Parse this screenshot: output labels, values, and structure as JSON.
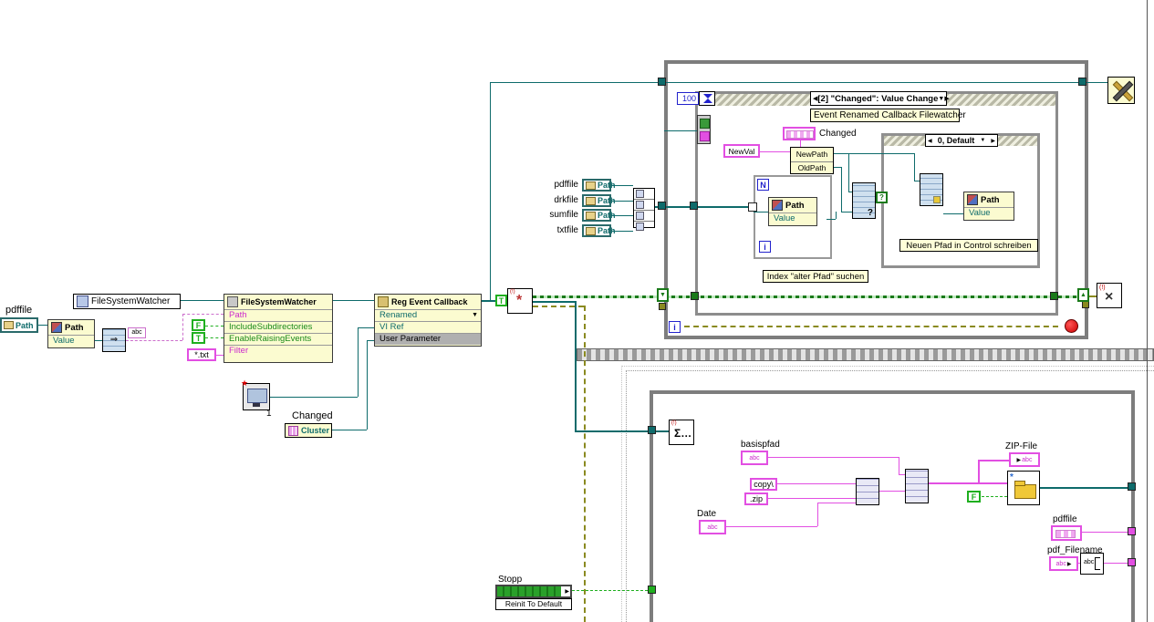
{
  "colors": {
    "wire_path": "#0e6b6b",
    "wire_string": "#e24fe2",
    "wire_bool": "#1faf1f",
    "wire_error": "#8a8a20",
    "wire_numeric": "#2222cc",
    "node_bg": "#fbfbd0",
    "free_label_bg": "#ffffd8",
    "structure_border": "#7d7d7d"
  },
  "glyphs": {
    "left_arrow": "◀",
    "right_arrow": "▶",
    "down_arrow": "▼",
    "up_arrow": "▲",
    "question": "?",
    "star": "★",
    "cross": "×",
    "asterisk": "*",
    "sigma": "Σ…",
    "bang": "(!)",
    "small_arrow": "▶"
  },
  "left_section": {
    "pdffile_label": "pdffile",
    "path_terminal": "Path",
    "path_value_node": {
      "header": "Path",
      "value": "Value"
    },
    "abc_small": "abc",
    "fsw_constant": "FileSystemWatcher",
    "property_node": {
      "title": "FileSystemWatcher",
      "rows": [
        {
          "label": "Path"
        },
        {
          "label": "IncludeSubdirectories"
        },
        {
          "label": "EnableRaisingEvents"
        },
        {
          "label": "Filter"
        }
      ]
    },
    "false_constant": "F",
    "true_constant": "T",
    "true_constant2": "T",
    "filter_constant": "*.txt",
    "reg_event_node": {
      "title": "Reg Event Callback",
      "rows": [
        "Renamed",
        "VI Ref",
        "User Parameter"
      ]
    },
    "vi_number": "1",
    "changed_label": "Changed",
    "cluster_constant": "Cluster"
  },
  "file_terminals": {
    "terminal": "Path",
    "items": [
      {
        "label": "pdffile"
      },
      {
        "label": "drkfile"
      },
      {
        "label": "sumfile"
      },
      {
        "label": "txtfile"
      }
    ]
  },
  "event_structure": {
    "timeout_value": "100",
    "selector": {
      "text": "[2] \"Changed\": Value Change"
    },
    "title_label": "Event Renamed Callback Filewatcher",
    "newval": "NewVal",
    "changed_label": "Changed",
    "unbundle_rows": [
      {
        "label": "NewPath"
      },
      {
        "label": "OldPath"
      }
    ],
    "case_selector": "0, Default",
    "for_loop": {
      "n": "N",
      "i": "i",
      "path_header": "Path",
      "value": "Value"
    },
    "write_node": {
      "path_header": "Path",
      "value": "Value"
    },
    "label_index": "Index \"alter Pfad\" suchen",
    "label_write": "Neuen Pfad in Control schreiben",
    "while_i": "i"
  },
  "bottom_section": {
    "stopp_label": "Stopp",
    "reinit_label": "Reinit To Default",
    "basispfad_label": "basispfad",
    "copy_constant": "copy\\",
    "zip_constant": ".zip",
    "date_label": "Date",
    "zipfile_label": "ZIP-File",
    "false_constant": "F",
    "pdffile_label": "pdffile",
    "pdf_filename_label": "pdf_Filename",
    "abc": "abc"
  }
}
